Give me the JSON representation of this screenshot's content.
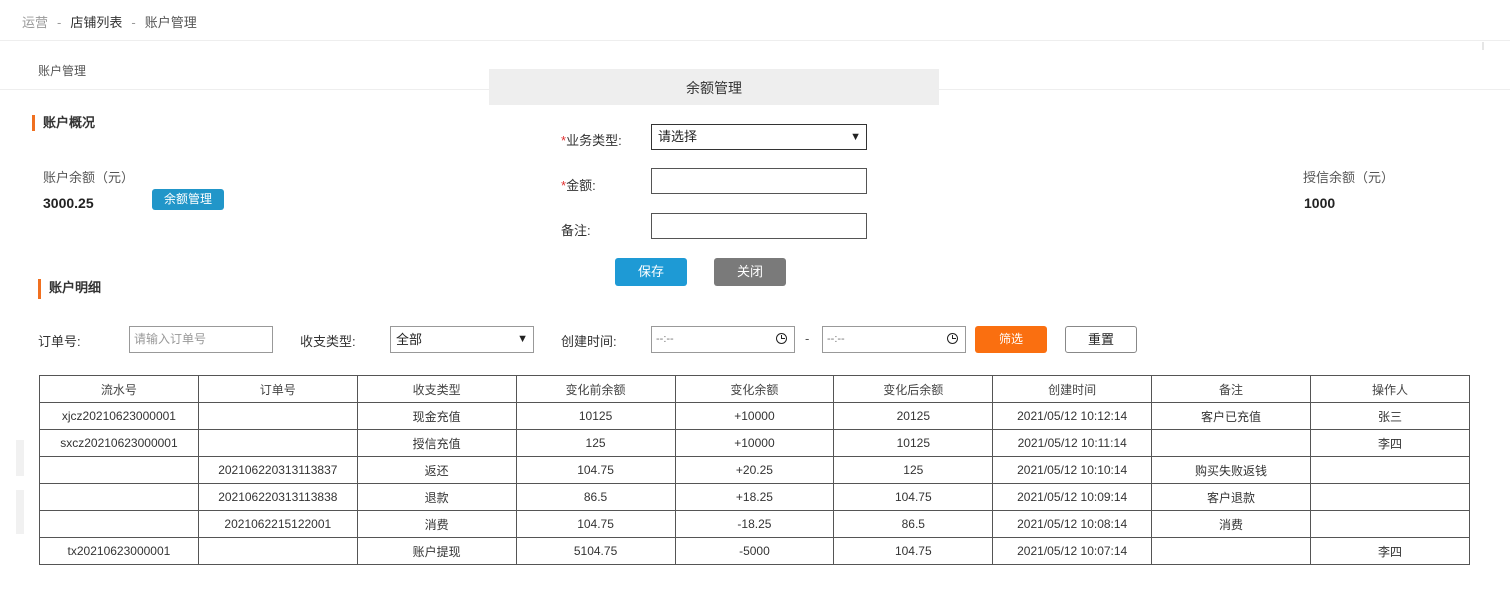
{
  "breadcrumb": [
    "运营",
    "店铺列表",
    "账户管理"
  ],
  "breadcrumb_sep": "-",
  "subtab": "账户管理",
  "overview": {
    "title": "账户概况",
    "balance_label": "账户余额（元）",
    "balance_value": "3000.25",
    "manage_button": "余额管理",
    "credit_label": "授信余额（元）",
    "credit_value": "1000"
  },
  "modal": {
    "title": "余额管理",
    "biz_type_label": "业务类型:",
    "biz_type_value": "请选择",
    "amount_label": "金额:",
    "amount_value": "",
    "note_label": "备注:",
    "note_value": "",
    "required_mark": "*",
    "save": "保存",
    "close": "关闭"
  },
  "detail": {
    "title": "账户明细",
    "order_label": "订单号:",
    "order_placeholder": "请输入订单号",
    "type_label": "收支类型:",
    "type_value": "全部",
    "time_label": "创建时间:",
    "time_start": "--:--",
    "time_end": "--:--",
    "dash": "-",
    "filter_button": "筛选",
    "reset_button": "重置"
  },
  "table": {
    "headers": [
      "流水号",
      "订单号",
      "收支类型",
      "变化前余额",
      "变化余额",
      "变化后余额",
      "创建时间",
      "备注",
      "操作人"
    ],
    "rows": [
      [
        "xjcz20210623000001",
        "",
        "现金充值",
        "10125",
        "+10000",
        "20125",
        "2021/05/12 10:12:14",
        "客户已充值",
        "张三"
      ],
      [
        "sxcz20210623000001",
        "",
        "授信充值",
        "125",
        "+10000",
        "10125",
        "2021/05/12 10:11:14",
        "",
        "李四"
      ],
      [
        "",
        "202106220313113837",
        "返还",
        "104.75",
        "+20.25",
        "125",
        "2021/05/12 10:10:14",
        "购买失败返钱",
        ""
      ],
      [
        "",
        "202106220313113838",
        "退款",
        "86.5",
        "+18.25",
        "104.75",
        "2021/05/12 10:09:14",
        "客户退款",
        ""
      ],
      [
        "",
        "2021062215122001",
        "消费",
        "104.75",
        "-18.25",
        "86.5",
        "2021/05/12 10:08:14",
        "消费",
        ""
      ],
      [
        "tx20210623000001",
        "",
        "账户提现",
        "5104.75",
        "-5000",
        "104.75",
        "2021/05/12 10:07:14",
        "",
        "李四"
      ]
    ]
  },
  "colors": {
    "accent_orange": "#fa6f10",
    "primary_blue": "#1e9ad5",
    "gray_button": "#7a7a7a"
  }
}
